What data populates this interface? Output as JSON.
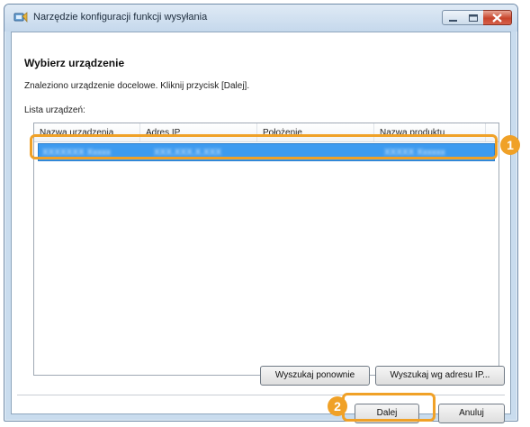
{
  "window": {
    "title": "Narzędzie konfiguracji funkcji wysyłania"
  },
  "page": {
    "heading": "Wybierz urządzenie",
    "description": "Znaleziono urządzenie docelowe. Kliknij przycisk [Dalej].",
    "list_label": "Lista urządzeń:"
  },
  "device_list": {
    "columns": [
      "Nazwa urządzenia",
      "Adres IP",
      "Położenie",
      "Nazwa produktu"
    ],
    "selected_row": {
      "device_name": "XXXXXXX Xxxxx",
      "ip_address": "XXX.XXX.X.XXX",
      "location": "",
      "product_name": "XXXXX Xxxxxx"
    }
  },
  "buttons": {
    "search_again": "Wyszukaj ponownie",
    "search_by_ip": "Wyszukaj wg adresu IP...",
    "next": "Dalej",
    "cancel": "Anuluj"
  },
  "callouts": {
    "first": "1",
    "second": "2"
  },
  "colors": {
    "callout": "#f0a127",
    "selection": "#3d9bf0"
  }
}
